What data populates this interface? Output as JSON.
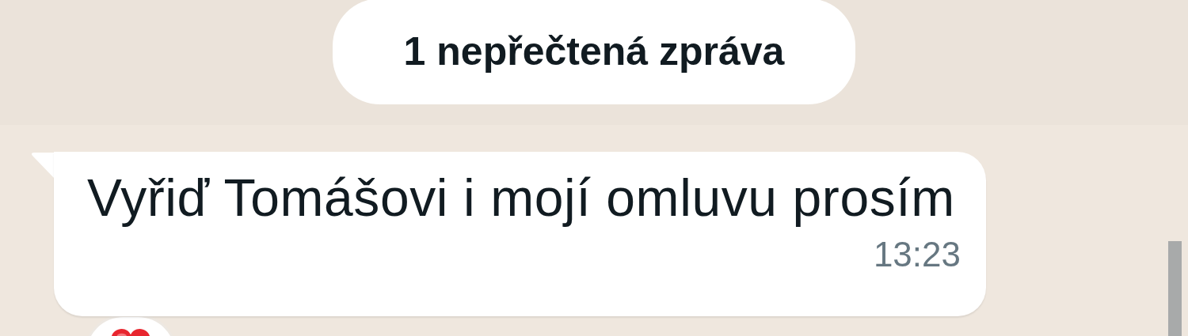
{
  "unread_banner": {
    "text": "1 nepřečtená zpráva"
  },
  "messages": [
    {
      "kind": "incoming",
      "text": "Vyřiď Tomášovi i mojí omluvu prosím",
      "time": "13:23",
      "reaction": {
        "kind": "heart"
      }
    }
  ]
}
